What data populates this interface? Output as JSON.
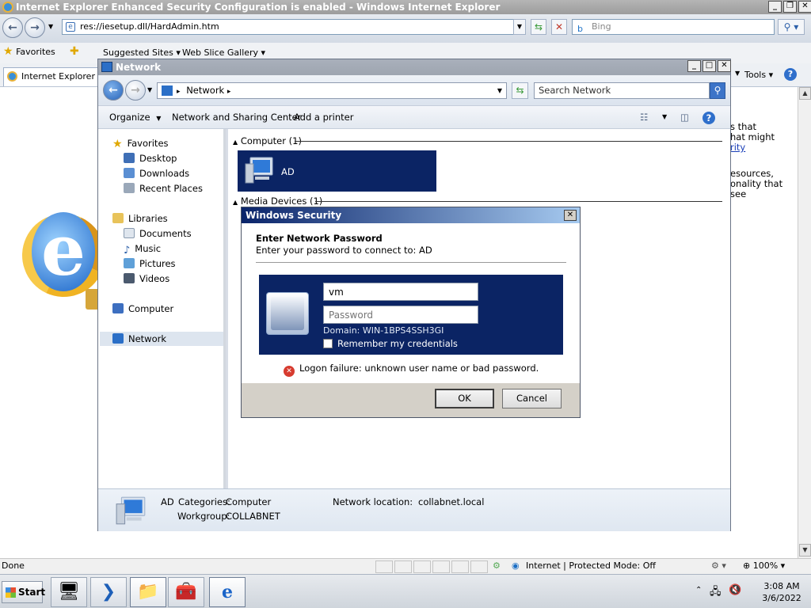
{
  "ie": {
    "title": "Internet Explorer Enhanced Security Configuration is enabled - Windows Internet Explorer",
    "address": "res://iesetup.dll/HardAdmin.htm",
    "search_placeholder": "Bing",
    "favorites_label": "Favorites",
    "suggested_sites": "Suggested Sites",
    "web_slice": "Web Slice Gallery",
    "tab_title": "Internet Explorer Enhanced Security Configuration is enabled",
    "tools_label": "Tools",
    "side_text": [
      "s that",
      "hat might",
      "rity",
      "esources,",
      "onality that",
      "see"
    ],
    "status_text": "Done",
    "zone_text": "Internet | Protected Mode: Off",
    "zoom_text": "100%"
  },
  "network": {
    "title": "Network",
    "address": "Network",
    "search_placeholder": "Search Network",
    "commands": [
      "Organize",
      "Network and Sharing Center",
      "Add a printer"
    ],
    "nav": {
      "favorites": "Favorites",
      "desktop": "Desktop",
      "downloads": "Downloads",
      "recent": "Recent Places",
      "libraries": "Libraries",
      "documents": "Documents",
      "music": "Music",
      "pictures": "Pictures",
      "videos": "Videos",
      "computer": "Computer",
      "network": "Network"
    },
    "groups": {
      "computer": "Computer (1)",
      "media": "Media Devices (1)"
    },
    "computer_item": "AD",
    "details": {
      "name": "AD",
      "categories_label": "Categories:",
      "categories_value": "Computer",
      "workgroup_label": "Workgroup:",
      "workgroup_value": "COLLABNET",
      "location_label": "Network location:",
      "location_value": "collabnet.local"
    }
  },
  "security": {
    "title": "Windows Security",
    "heading": "Enter Network Password",
    "subheading": "Enter your password to connect to: AD",
    "username_value": "vm",
    "password_placeholder": "Password",
    "domain": "Domain: WIN-1BPS4SSH3GI",
    "remember": "Remember my credentials",
    "error": "Logon failure: unknown user name or bad password.",
    "ok": "OK",
    "cancel": "Cancel"
  },
  "taskbar": {
    "start": "Start",
    "time": "3:08 AM",
    "date": "3/6/2022"
  }
}
